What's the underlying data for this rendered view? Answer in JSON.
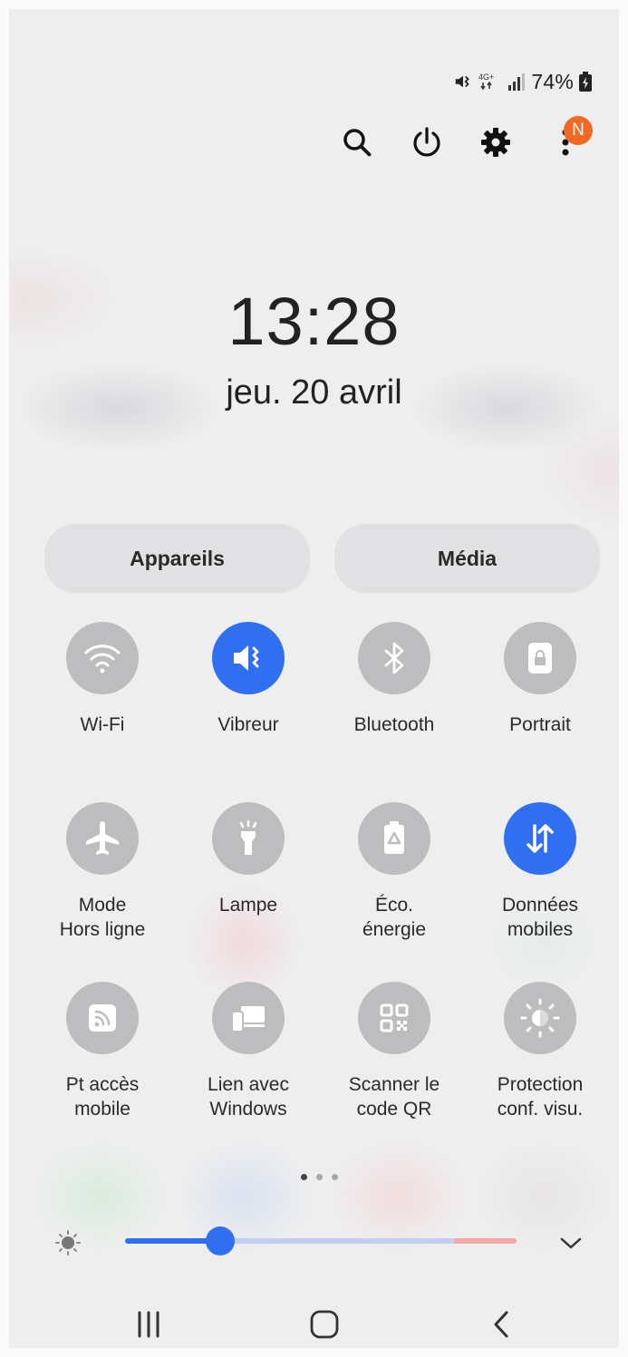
{
  "status_bar": {
    "network": "4G+",
    "battery_percent": "74%"
  },
  "top_actions": {
    "profile_badge": "N"
  },
  "clock": {
    "time": "13:28",
    "date": "jeu. 20 avril"
  },
  "pills": {
    "devices": "Appareils",
    "media": "Média"
  },
  "tiles": [
    {
      "label": "Wi-Fi",
      "icon": "wifi-icon",
      "active": false
    },
    {
      "label": "Vibreur",
      "icon": "vibrate-icon",
      "active": true
    },
    {
      "label": "Bluetooth",
      "icon": "bluetooth-icon",
      "active": false
    },
    {
      "label": "Portrait",
      "icon": "portrait-lock-icon",
      "active": false
    },
    {
      "label": "Mode\nHors ligne",
      "icon": "airplane-icon",
      "active": false
    },
    {
      "label": "Lampe",
      "icon": "flashlight-icon",
      "active": false
    },
    {
      "label": "Éco.\nénergie",
      "icon": "battery-saver-icon",
      "active": false
    },
    {
      "label": "Données\nmobiles",
      "icon": "mobile-data-icon",
      "active": true
    },
    {
      "label": "Pt accès\nmobile",
      "icon": "hotspot-icon",
      "active": false
    },
    {
      "label": "Lien avec\nWindows",
      "icon": "link-windows-icon",
      "active": false
    },
    {
      "label": "Scanner le\ncode QR",
      "icon": "qr-code-icon",
      "active": false
    },
    {
      "label": "Protection\nconf. visu.",
      "icon": "eye-comfort-icon",
      "active": false
    }
  ],
  "pager": {
    "pages": 3,
    "current": 1
  },
  "brightness": {
    "level": 0.24
  },
  "colors": {
    "accent": "#2f6ff0",
    "tile_off": "#bdbdbf",
    "badge": "#f06a25"
  }
}
